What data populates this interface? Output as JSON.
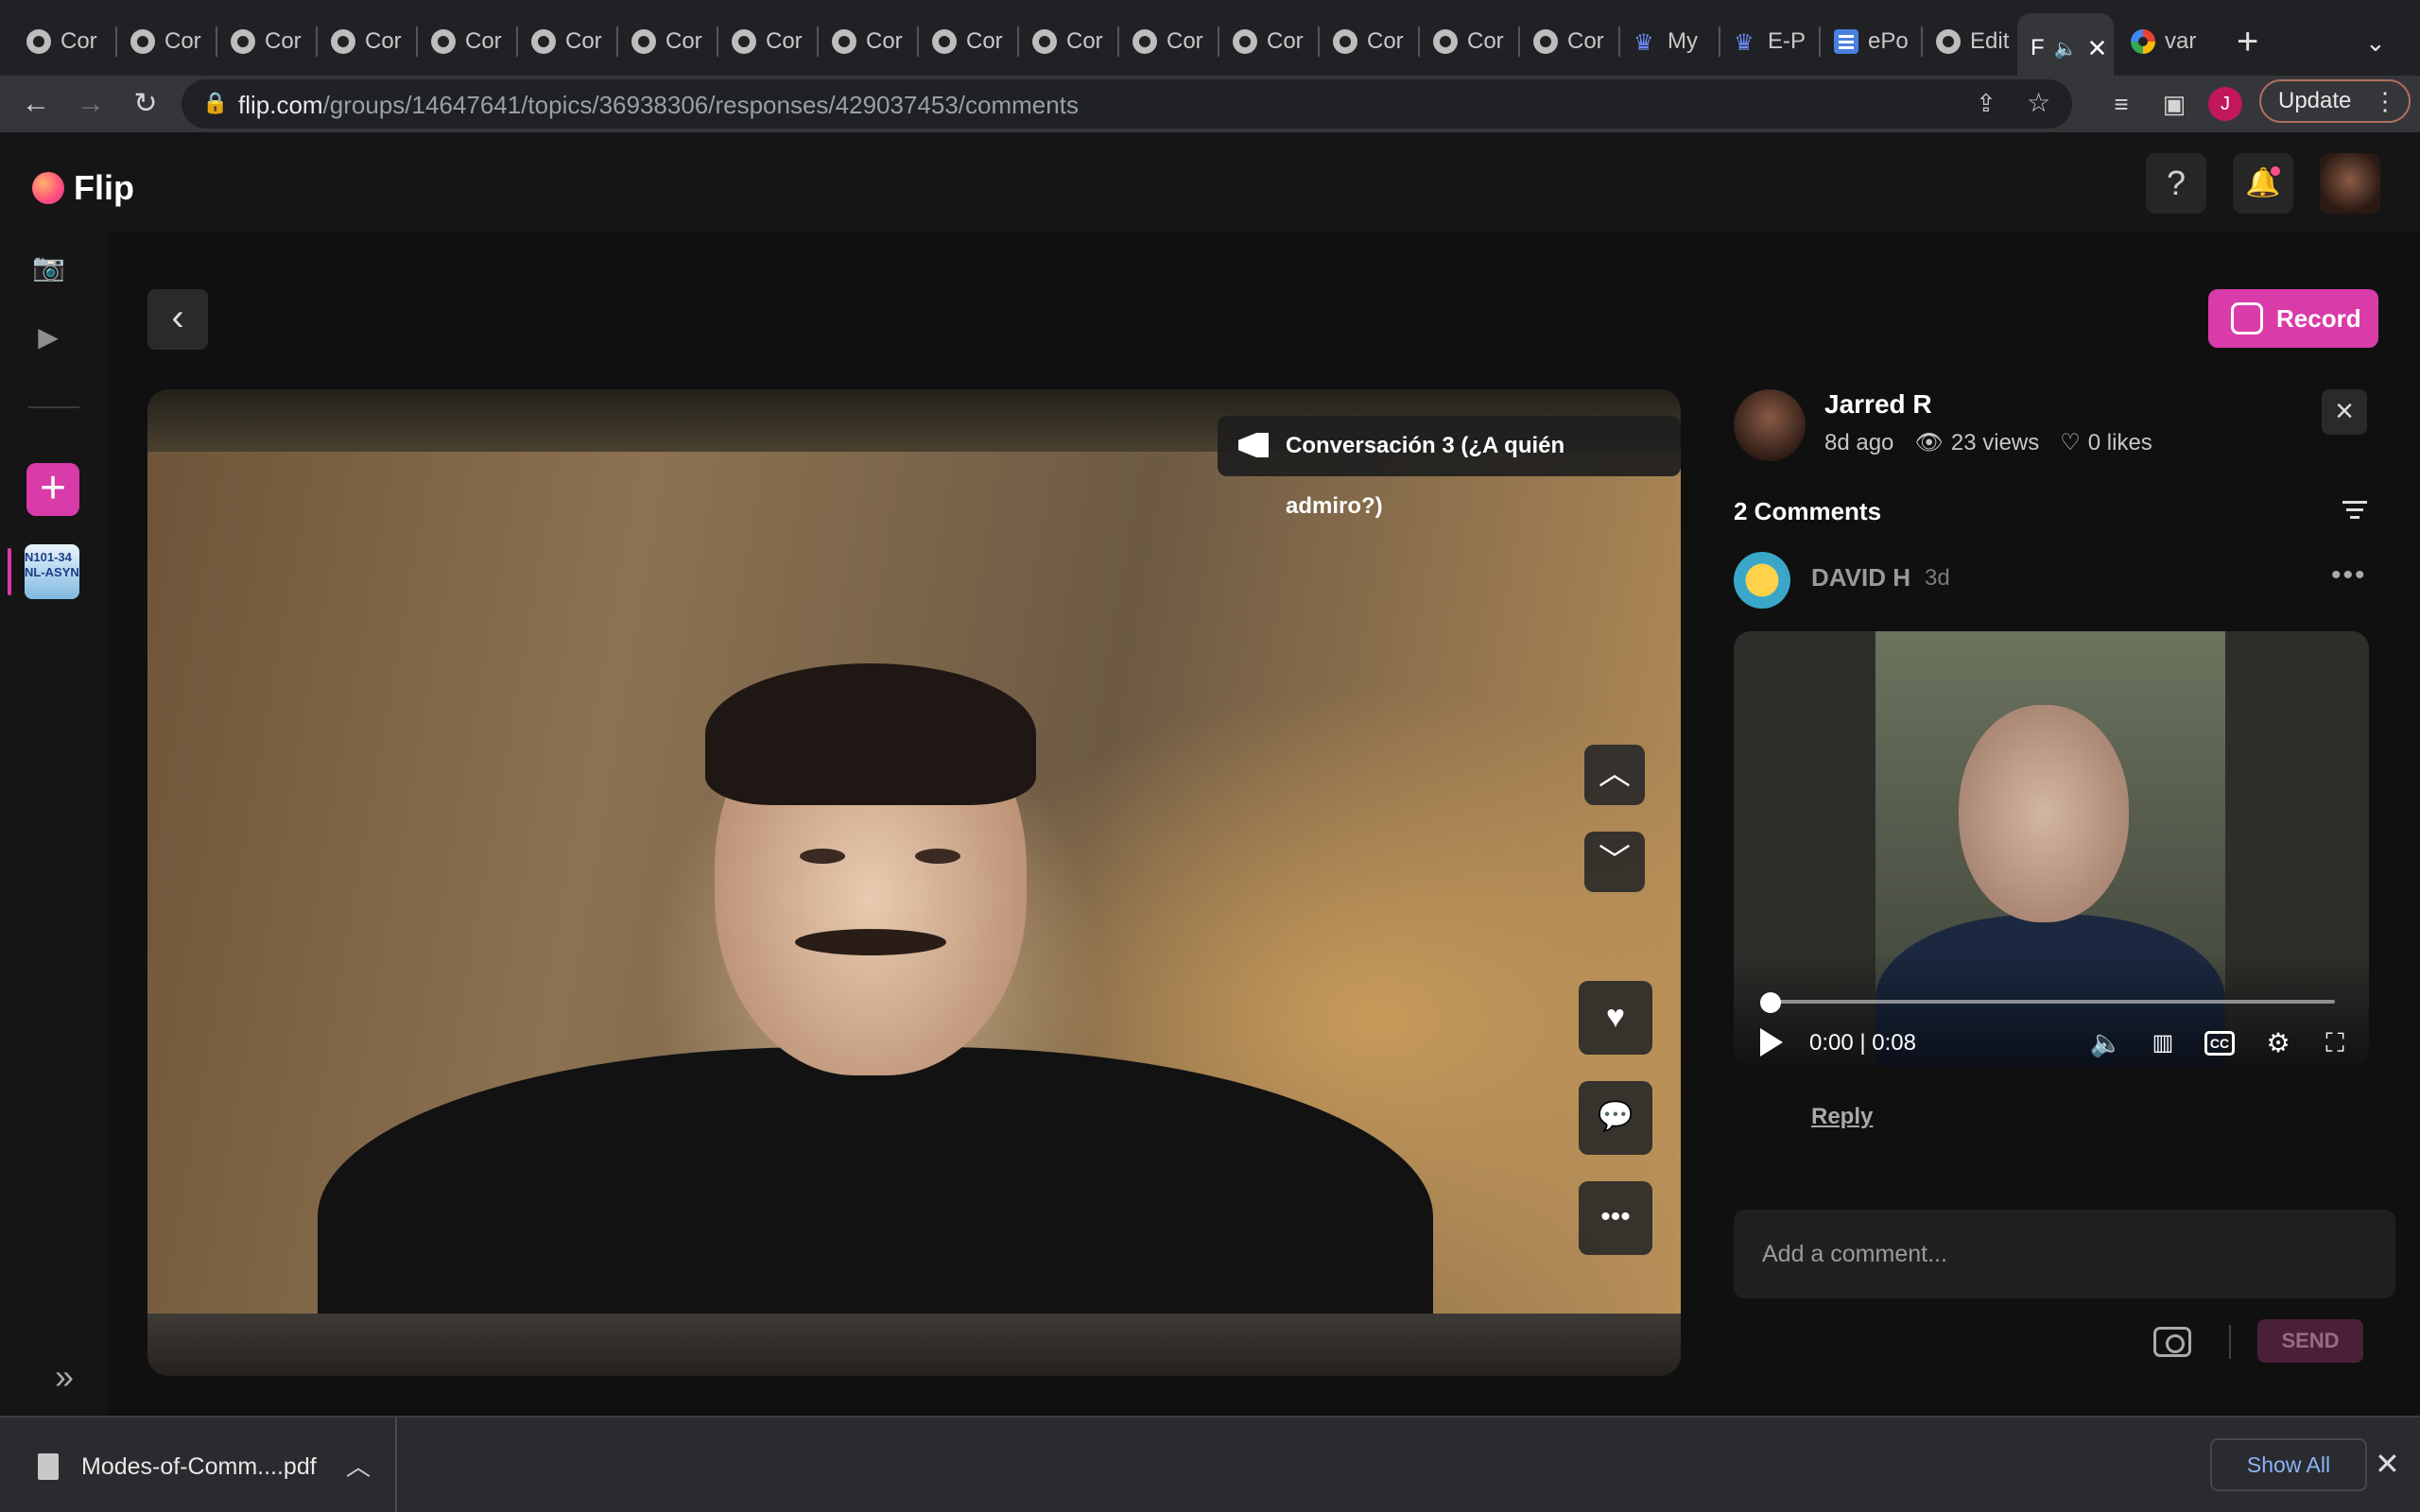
{
  "browser": {
    "tabs": [
      {
        "label": "Cor",
        "icon": "globe-icon"
      },
      {
        "label": "Cor",
        "icon": "globe-icon"
      },
      {
        "label": "Cor",
        "icon": "globe-icon"
      },
      {
        "label": "Cor",
        "icon": "globe-icon"
      },
      {
        "label": "Cor",
        "icon": "globe-icon"
      },
      {
        "label": "Cor",
        "icon": "globe-icon"
      },
      {
        "label": "Cor",
        "icon": "globe-icon"
      },
      {
        "label": "Cor",
        "icon": "globe-icon"
      },
      {
        "label": "Cor",
        "icon": "globe-icon"
      },
      {
        "label": "Cor",
        "icon": "globe-icon"
      },
      {
        "label": "Cor",
        "icon": "globe-icon"
      },
      {
        "label": "Cor",
        "icon": "globe-icon"
      },
      {
        "label": "Cor",
        "icon": "globe-icon"
      },
      {
        "label": "Cor",
        "icon": "globe-icon"
      },
      {
        "label": "Cor",
        "icon": "globe-icon"
      },
      {
        "label": "Cor",
        "icon": "globe-icon"
      },
      {
        "label": "My",
        "icon": "crown-icon"
      },
      {
        "label": "E-P",
        "icon": "crown-icon"
      },
      {
        "label": "ePo",
        "icon": "docs-icon"
      },
      {
        "label": "Edit",
        "icon": "globe-icon"
      },
      {
        "label": "F",
        "icon": "speaker-icon",
        "active": true
      },
      {
        "label": "var",
        "icon": "google-icon"
      }
    ],
    "url_host": "flip.com",
    "url_path": "/groups/14647641/topics/36938306/responses/429037453/comments",
    "profile_initial": "J",
    "update_label": "Update"
  },
  "app": {
    "brand": "Flip",
    "help_label": "?"
  },
  "rail": {
    "group_thumb_text": "N101-34 NL-ASYN"
  },
  "toolbar": {
    "record_label": "Record"
  },
  "video": {
    "topic_title": "Conversación 3 (¿A quién admiro?)"
  },
  "response": {
    "author": "Jarred R",
    "age": "8d ago",
    "views": "23 views",
    "likes": "0 likes"
  },
  "comments": {
    "title": "2 Comments",
    "items": [
      {
        "author": "DAVID H",
        "age": "3d",
        "time_display": "0:00 | 0:08",
        "progress_fraction": 0.0,
        "reply_label": "Reply"
      }
    ],
    "input_placeholder": "Add a comment...",
    "send_label": "SEND"
  },
  "downloads": {
    "file_name": "Modes-of-Comm....pdf",
    "show_all_label": "Show All"
  },
  "colors": {
    "accent": "#d93ba8",
    "background": "#101010",
    "panel": "#202020"
  }
}
